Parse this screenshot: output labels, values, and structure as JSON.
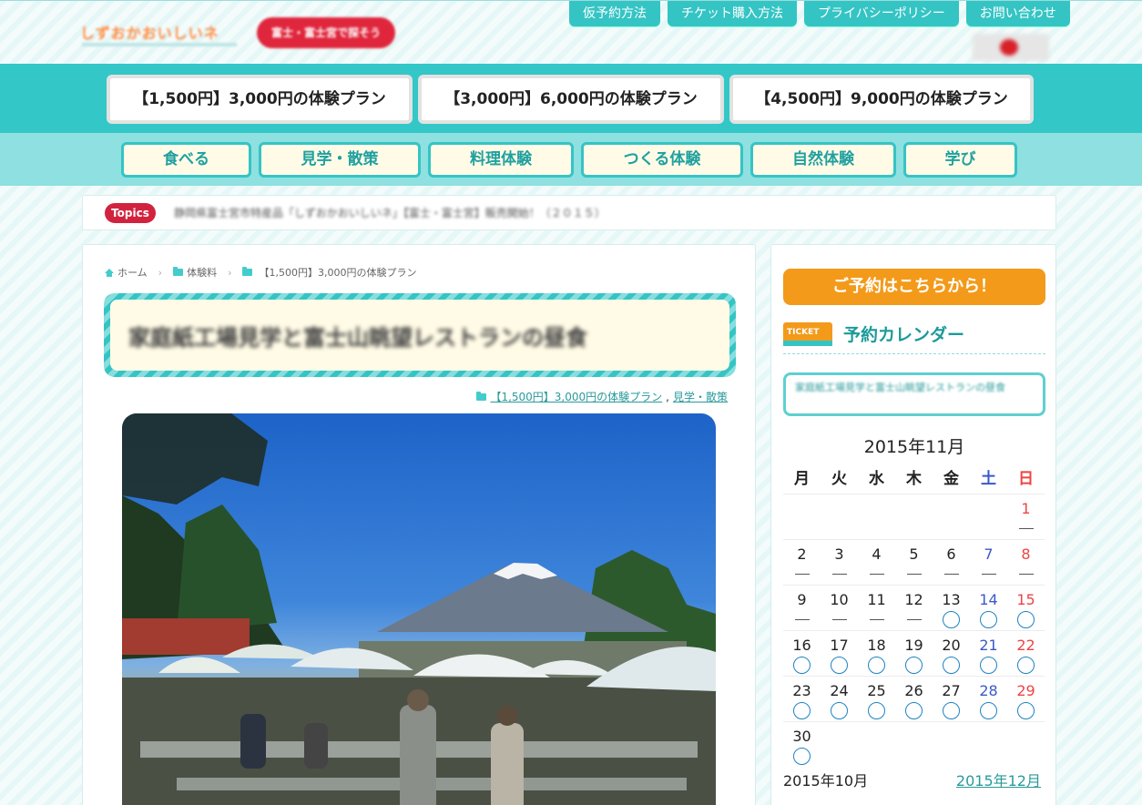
{
  "header": {
    "logo_text": "しずおかおいしいネ",
    "badge_text": "富士・富士宮で探そう",
    "top_nav": [
      "仮予約方法",
      "チケット購入方法",
      "プライバシーポリシー",
      "お問い合わせ"
    ]
  },
  "plans": [
    "【1,500円】3,000円の体験プラン",
    "【3,000円】6,000円の体験プラン",
    "【4,500円】9,000円の体験プラン"
  ],
  "categories": [
    "食べる",
    "見学・散策",
    "料理体験",
    "つくる体験",
    "自然体験",
    "学び"
  ],
  "topics": {
    "badge": "Topics",
    "text": "静岡県富士宮市特産品「しずおかおいしいネ」【富士・富士宮】販売開始！（２０１５）"
  },
  "breadcrumb": [
    "ホーム",
    "体験料",
    "【1,500円】3,000円の体験プラン"
  ],
  "article": {
    "title": "家庭紙工場見学と富士山眺望レストランの昼食",
    "cat_links": [
      "【1,500円】3,000円の体験プラン",
      "見学・散策"
    ],
    "cat_separator": ","
  },
  "sidebar": {
    "reserve_button": "ご予約はこちらから！",
    "calendar_heading": "予約カレンダー",
    "event_title": "家庭紙工場見学と富士山眺望レストランの昼食",
    "month": "2015年11月",
    "weekdays": [
      "月",
      "火",
      "水",
      "木",
      "金",
      "土",
      "日"
    ],
    "days": [
      {
        "d": "",
        "s": ""
      },
      {
        "d": "",
        "s": ""
      },
      {
        "d": "",
        "s": ""
      },
      {
        "d": "",
        "s": ""
      },
      {
        "d": "",
        "s": ""
      },
      {
        "d": "",
        "s": ""
      },
      {
        "d": "1",
        "s": "—"
      },
      {
        "d": "2",
        "s": "—"
      },
      {
        "d": "3",
        "s": "—"
      },
      {
        "d": "4",
        "s": "—"
      },
      {
        "d": "5",
        "s": "—"
      },
      {
        "d": "6",
        "s": "—"
      },
      {
        "d": "7",
        "s": "—"
      },
      {
        "d": "8",
        "s": "—"
      },
      {
        "d": "9",
        "s": "—"
      },
      {
        "d": "10",
        "s": "—"
      },
      {
        "d": "11",
        "s": "—"
      },
      {
        "d": "12",
        "s": "—"
      },
      {
        "d": "13",
        "s": "○"
      },
      {
        "d": "14",
        "s": "○"
      },
      {
        "d": "15",
        "s": "○"
      },
      {
        "d": "16",
        "s": "○"
      },
      {
        "d": "17",
        "s": "○"
      },
      {
        "d": "18",
        "s": "○"
      },
      {
        "d": "19",
        "s": "○"
      },
      {
        "d": "20",
        "s": "○"
      },
      {
        "d": "21",
        "s": "○"
      },
      {
        "d": "22",
        "s": "○"
      },
      {
        "d": "23",
        "s": "○"
      },
      {
        "d": "24",
        "s": "○"
      },
      {
        "d": "25",
        "s": "○"
      },
      {
        "d": "26",
        "s": "○"
      },
      {
        "d": "27",
        "s": "○"
      },
      {
        "d": "28",
        "s": "○"
      },
      {
        "d": "29",
        "s": "○"
      },
      {
        "d": "30",
        "s": "○"
      },
      {
        "d": "",
        "s": ""
      },
      {
        "d": "",
        "s": ""
      },
      {
        "d": "",
        "s": ""
      },
      {
        "d": "",
        "s": ""
      },
      {
        "d": "",
        "s": ""
      },
      {
        "d": "",
        "s": ""
      }
    ],
    "prev_month": "2015年10月",
    "next_month": "2015年12月"
  },
  "colors": {
    "teal": "#33c7c7",
    "orange": "#f39a1a",
    "red_badge": "#d2233e"
  }
}
